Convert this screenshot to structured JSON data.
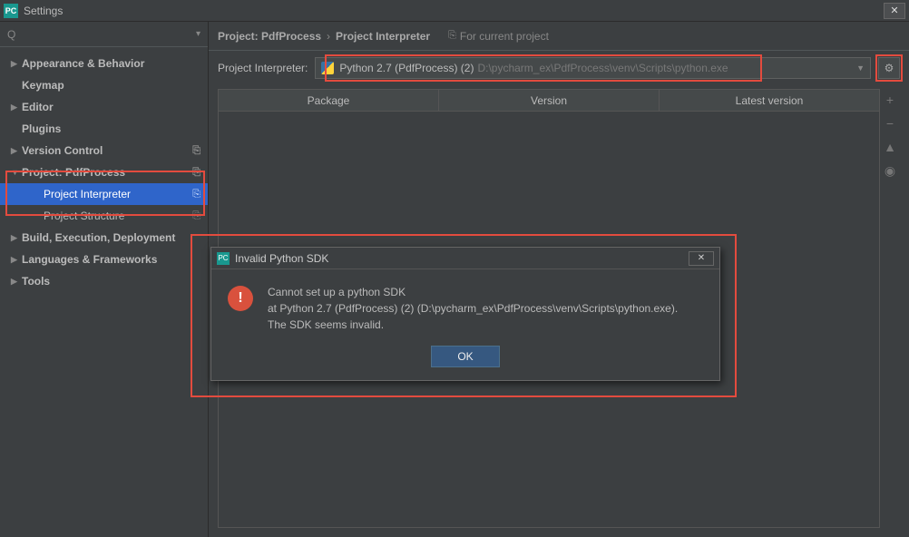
{
  "window": {
    "title": "Settings",
    "close_symbol": "✕"
  },
  "search": {
    "placeholder": "",
    "value": ""
  },
  "sidebar": {
    "items": [
      {
        "arrow": "▶",
        "label": "Appearance & Behavior",
        "bold": true
      },
      {
        "arrow": "",
        "label": "Keymap",
        "bold": true
      },
      {
        "arrow": "▶",
        "label": "Editor",
        "bold": true
      },
      {
        "arrow": "",
        "label": "Plugins",
        "bold": true
      },
      {
        "arrow": "▶",
        "label": "Version Control",
        "bold": true,
        "badge": "⎘"
      },
      {
        "arrow": "▼",
        "label": "Project: PdfProcess",
        "bold": true,
        "badge": "⎘"
      },
      {
        "arrow": "",
        "label": "Project Interpreter",
        "bold": false,
        "badge": "⎘",
        "indent": 2,
        "selected": true
      },
      {
        "arrow": "",
        "label": "Project Structure",
        "bold": false,
        "badge": "⎘",
        "indent": 2
      },
      {
        "arrow": "▶",
        "label": "Build, Execution, Deployment",
        "bold": true
      },
      {
        "arrow": "▶",
        "label": "Languages & Frameworks",
        "bold": true
      },
      {
        "arrow": "▶",
        "label": "Tools",
        "bold": true
      }
    ]
  },
  "breadcrumb": {
    "root": "Project: PdfProcess",
    "sep": "›",
    "leaf": "Project Interpreter",
    "note": "For current project"
  },
  "interpreter": {
    "label": "Project Interpreter:",
    "name": "Python 2.7 (PdfProcess) (2)",
    "path": "D:\\pycharm_ex\\PdfProcess\\venv\\Scripts\\python.exe"
  },
  "table": {
    "cols": [
      "Package",
      "Version",
      "Latest version"
    ]
  },
  "dialog": {
    "title": "Invalid Python SDK",
    "line1": "Cannot set up a python SDK",
    "line2": "at Python 2.7 (PdfProcess) (2) (D:\\pycharm_ex\\PdfProcess\\venv\\Scripts\\python.exe).",
    "line3": "The SDK seems invalid.",
    "ok": "OK"
  },
  "icons": {
    "gear": "⚙",
    "plus": "+",
    "minus": "−",
    "up": "▲",
    "eye": "◉",
    "q": "Q"
  }
}
